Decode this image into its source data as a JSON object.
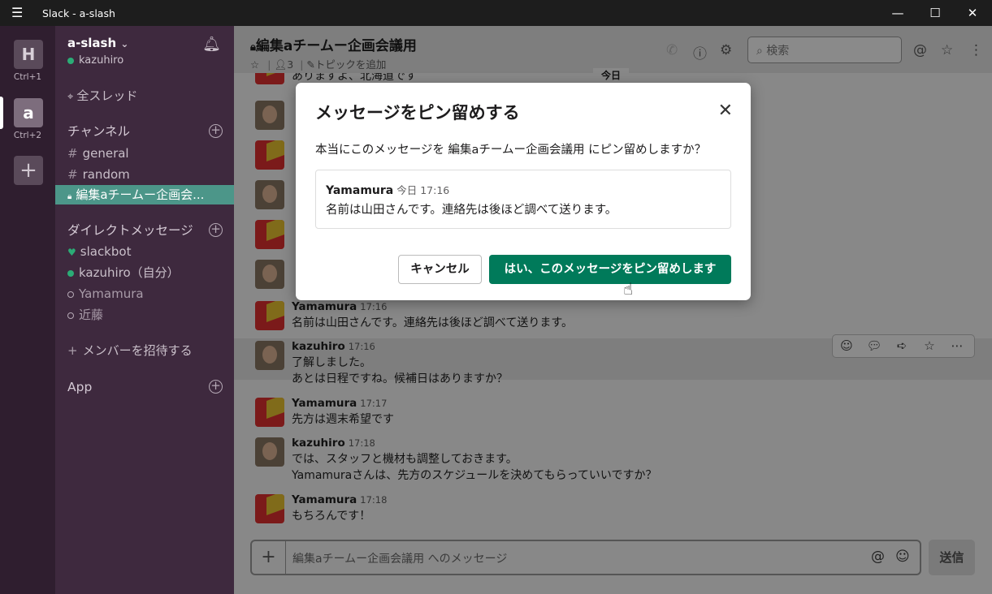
{
  "window": {
    "title": "Slack - a-slash",
    "menu_icon": "hamburger-icon",
    "controls": [
      "minimize-icon",
      "maximize-icon",
      "close-icon"
    ]
  },
  "workspaces": [
    {
      "letter": "H",
      "shortcut": "Ctrl+1"
    },
    {
      "letter": "a",
      "shortcut": "Ctrl+2",
      "active": true
    }
  ],
  "sidebar": {
    "team": "a-slash",
    "team_caret": "⌄",
    "user": "kazuhiro",
    "all_threads": "全スレッド",
    "channels_header": "チャンネル",
    "channels": [
      {
        "prefix": "#",
        "name": "general"
      },
      {
        "prefix": "#",
        "name": "random"
      },
      {
        "prefix": "🔒",
        "name": "編集aチームー企画会...",
        "active": true
      }
    ],
    "dm_header": "ダイレクトメッセージ",
    "dms": [
      {
        "name": "slackbot",
        "status": "heart"
      },
      {
        "name": "kazuhiro（自分）",
        "status": "online"
      },
      {
        "name": "Yamamura",
        "status": "offline"
      },
      {
        "name": "近藤",
        "status": "offline"
      }
    ],
    "invite": "メンバーを招待する",
    "apps_header": "App"
  },
  "channel": {
    "name": "編集aチームー企画会議用",
    "members": "3",
    "add_topic": "トピックを追加",
    "search_placeholder": "検索"
  },
  "day_label": "今日",
  "messages": [
    {
      "author": "",
      "time": "",
      "text": "ありますよ、北海道です",
      "avatar": "yamamura",
      "partial": true
    },
    {
      "author": "Yamamura",
      "time": "17:16",
      "text": "名前は山田さんです。連絡先は後ほど調べて送ります。",
      "avatar": "yamamura"
    },
    {
      "author": "kazuhiro",
      "time": "17:16",
      "text": "了解しました。",
      "text2": "あとは日程ですね。候補日はありますか？",
      "avatar": "kazuhiro"
    },
    {
      "author": "Yamamura",
      "time": "17:17",
      "text": "先方は週末希望です",
      "avatar": "yamamura"
    },
    {
      "author": "kazuhiro",
      "time": "17:18",
      "text": "では、スタッフと機材も調整しておきます。",
      "text2": "Yamamuraさんは、先方のスケジュールを決めてもらっていいですか？",
      "avatar": "kazuhiro"
    },
    {
      "author": "Yamamura",
      "time": "17:18",
      "text": "もちろんです！",
      "avatar": "yamamura"
    }
  ],
  "composer": {
    "placeholder": "編集aチームー企画会議用 へのメッセージ",
    "send": "送信"
  },
  "modal": {
    "title": "メッセージをピン留めする",
    "body": "本当にこのメッセージを 編集aチームー企画会議用 にピン留めしますか？",
    "quote_author": "Yamamura",
    "quote_time": "今日 17:16",
    "quote_text": "名前は山田さんです。連絡先は後ほど調べて送ります。",
    "cancel": "キャンセル",
    "confirm": "はい、このメッセージをピン留めします"
  },
  "colors": {
    "sidebar": "#3e293e",
    "active_channel": "#4c9689",
    "confirm_button": "#007a5a"
  }
}
